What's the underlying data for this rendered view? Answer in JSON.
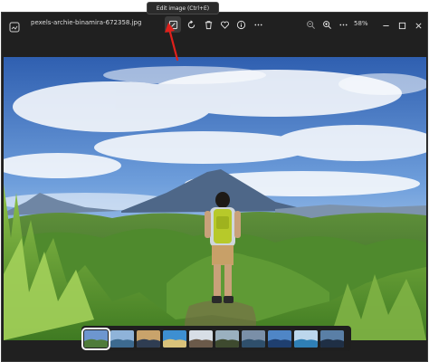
{
  "tooltip": {
    "text": "Edit image (Ctrl+E)"
  },
  "titlebar": {
    "filename": "pexels-archie-binamira-672358.jpg",
    "zoom_level": "58%"
  },
  "toolbar": {
    "icons": [
      "edit-image-icon",
      "rotate-icon",
      "delete-icon",
      "favorite-icon",
      "info-icon",
      "more-icon",
      "zoom-out-icon",
      "zoom-in-icon",
      "more-icon"
    ]
  },
  "window_controls": [
    "minimize-icon",
    "maximize-icon",
    "close-icon"
  ],
  "filmstrip": {
    "selected_index": 0,
    "thumbnails": [
      {
        "colors": [
          "#6d96cf",
          "#4f7b3a"
        ]
      },
      {
        "colors": [
          "#8fb3d9",
          "#3d6a8f"
        ]
      },
      {
        "colors": [
          "#c9a36b",
          "#2f3d52"
        ]
      },
      {
        "colors": [
          "#3d8fd1",
          "#d9c27a"
        ]
      },
      {
        "colors": [
          "#d7dee6",
          "#6b5a4a"
        ]
      },
      {
        "colors": [
          "#9ab0bf",
          "#3e4a2f"
        ]
      },
      {
        "colors": [
          "#7a8fa8",
          "#2f4f6b"
        ]
      },
      {
        "colors": [
          "#4f86c6",
          "#1f3f6f"
        ]
      },
      {
        "colors": [
          "#bcd6ec",
          "#2f7fb5"
        ]
      },
      {
        "colors": [
          "#5a7fa6",
          "#1f2f45"
        ]
      }
    ]
  },
  "colors": {
    "annotation_arrow": "#e0201b",
    "window_bg": "#202020"
  }
}
